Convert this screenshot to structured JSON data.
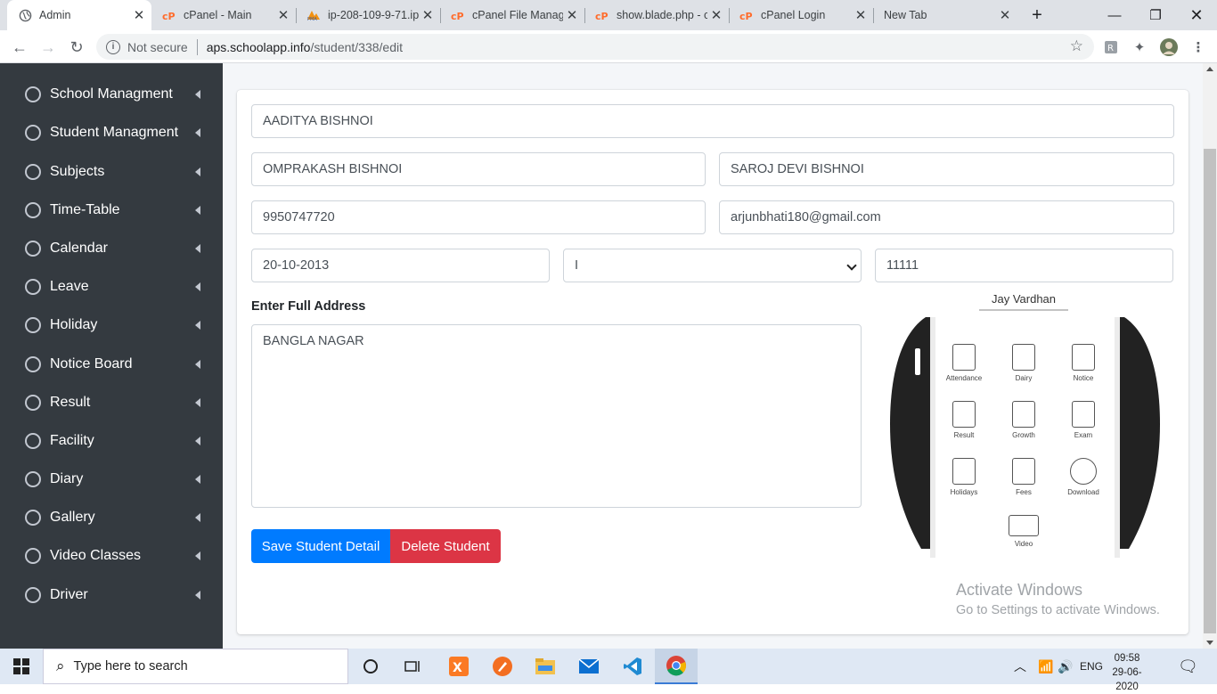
{
  "browser": {
    "tabs": [
      {
        "title": "Admin",
        "active": true
      },
      {
        "title": "cPanel - Main",
        "active": false
      },
      {
        "title": "ip-208-109-9-71.ip",
        "active": false
      },
      {
        "title": "cPanel File Manag",
        "active": false
      },
      {
        "title": "show.blade.php - c",
        "active": false
      },
      {
        "title": "cPanel Login",
        "active": false
      },
      {
        "title": "New Tab",
        "active": false
      }
    ],
    "security_label": "Not secure",
    "url_host": "aps.schoolapp.info",
    "url_path": "/student/338/edit"
  },
  "sidebar": {
    "items": [
      {
        "label": "School Managment"
      },
      {
        "label": "Student Managment"
      },
      {
        "label": "Subjects"
      },
      {
        "label": "Time-Table"
      },
      {
        "label": "Calendar"
      },
      {
        "label": "Leave"
      },
      {
        "label": "Holiday"
      },
      {
        "label": "Notice Board"
      },
      {
        "label": "Result"
      },
      {
        "label": "Facility"
      },
      {
        "label": "Diary"
      },
      {
        "label": "Gallery"
      },
      {
        "label": "Video Classes"
      },
      {
        "label": "Driver"
      }
    ]
  },
  "form": {
    "student_name": "AADITYA BISHNOI",
    "father_name": "OMPRAKASH BISHNOI",
    "mother_name": "SAROJ DEVI BISHNOI",
    "phone": "9950747720",
    "email": "arjunbhati180@gmail.com",
    "dob": "20-10-2013",
    "class_selected": "I",
    "roll_no": "11111",
    "address_label": "Enter Full Address",
    "address": "BANGLA NAGAR",
    "save_label": "Save Student Detail",
    "delete_label": "Delete Student"
  },
  "preview": {
    "header": "Jay Vardhan",
    "apps": [
      "Attendance",
      "Dairy",
      "Notice",
      "Result",
      "Growth",
      "Exam",
      "Holidays",
      "Fees",
      "Download",
      "Video"
    ]
  },
  "watermark": {
    "line1": "Activate Windows",
    "line2": "Go to Settings to activate Windows."
  },
  "taskbar": {
    "search_placeholder": "Type here to search",
    "language": "ENG",
    "time": "09:58",
    "date": "29-06-2020"
  },
  "colors": {
    "sidebar_bg": "#343a40",
    "primary": "#007bff",
    "danger": "#dc3545",
    "cpanel_orange": "#ff6c2c"
  }
}
